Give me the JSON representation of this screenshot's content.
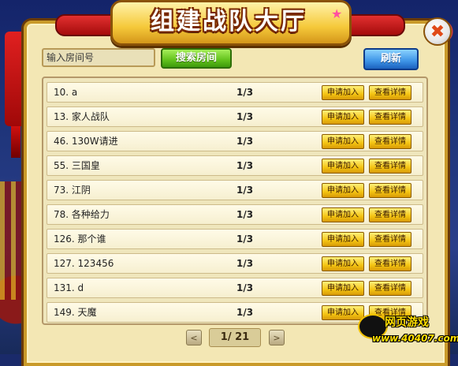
{
  "window": {
    "title": "组建战队大厅",
    "close_symbol": "✖"
  },
  "toolbar": {
    "search_value": "输入房间号",
    "search_button": "搜索房间",
    "refresh_button": "刷新"
  },
  "rooms": [
    {
      "name": "10. a",
      "count": "1/3",
      "join": "申请加入",
      "detail": "查看详情"
    },
    {
      "name": "13. 家人战队",
      "count": "1/3",
      "join": "申请加入",
      "detail": "查看详情"
    },
    {
      "name": "46. 130W请进",
      "count": "1/3",
      "join": "申请加入",
      "detail": "查看详情"
    },
    {
      "name": "55. 三国皇",
      "count": "1/3",
      "join": "申请加入",
      "detail": "查看详情"
    },
    {
      "name": "73. 江阴",
      "count": "1/3",
      "join": "申请加入",
      "detail": "查看详情"
    },
    {
      "name": "78. 各种给力",
      "count": "1/3",
      "join": "申请加入",
      "detail": "查看详情"
    },
    {
      "name": "126. 那个谁",
      "count": "1/3",
      "join": "申请加入",
      "detail": "查看详情"
    },
    {
      "name": "127. 123456",
      "count": "1/3",
      "join": "申请加入",
      "detail": "查看详情"
    },
    {
      "name": "131. d",
      "count": "1/3",
      "join": "申请加入",
      "detail": "查看详情"
    },
    {
      "name": "149. 天魔",
      "count": "1/3",
      "join": "申请加入",
      "detail": "查看详情"
    }
  ],
  "pager": {
    "label": "1/ 21",
    "prev_symbol": "<",
    "next_symbol": ">"
  },
  "watermark": {
    "line1": "网页游戏",
    "line2": "www.40407.com"
  }
}
